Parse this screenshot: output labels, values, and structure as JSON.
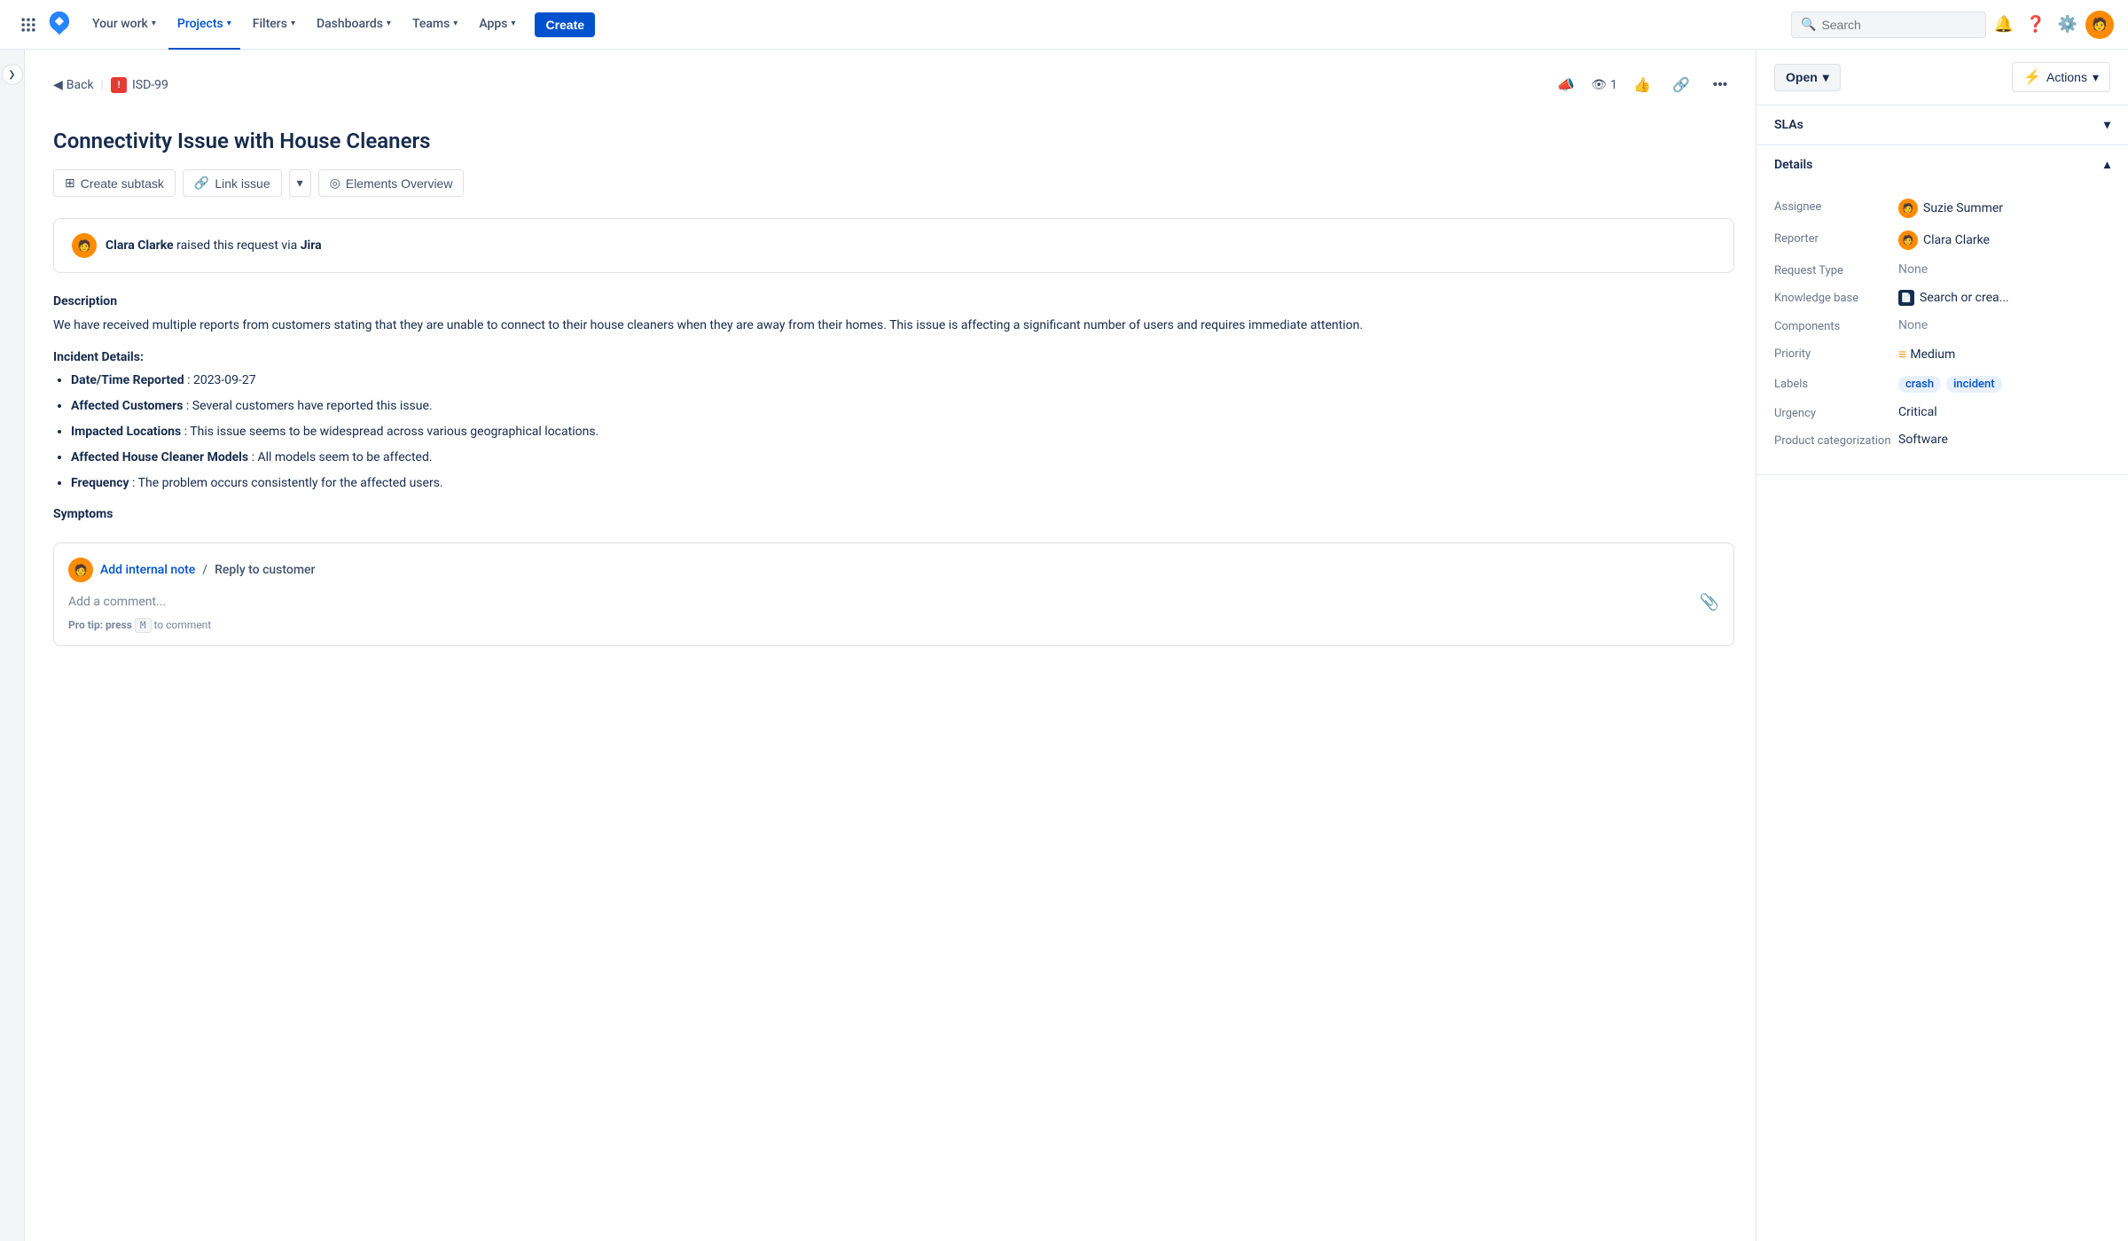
{
  "nav": {
    "your_work": "Your work",
    "projects": "Projects",
    "filters": "Filters",
    "dashboards": "Dashboards",
    "teams": "Teams",
    "apps": "Apps",
    "create": "Create",
    "search_placeholder": "Search"
  },
  "breadcrumb": {
    "back": "Back",
    "issue_id": "ISD-99"
  },
  "header_actions": {
    "watch_count": "1",
    "watch_label": "1"
  },
  "issue": {
    "title": "Connectivity Issue with House Cleaners",
    "toolbar": {
      "create_subtask": "Create subtask",
      "link_issue": "Link issue",
      "elements_overview": "Elements Overview"
    },
    "reporter_card": "raised this request via",
    "reporter_name": "Clara Clarke",
    "reporter_via": "Jira",
    "description_title": "Description",
    "description_text": "We have received multiple reports from customers stating that they are unable to connect to their house cleaners when they are away from their homes. This issue is affecting a significant number of users and requires immediate attention.",
    "incident_title": "Incident Details",
    "incident_items": [
      {
        "label": "Date/Time Reported",
        "value": "2023-09-27"
      },
      {
        "label": "Affected Customers",
        "value": "Several customers have reported this issue."
      },
      {
        "label": "Impacted Locations",
        "value": "This issue seems to be widespread across various geographical locations."
      },
      {
        "label": "Affected House Cleaner Models",
        "value": "All models seem to be affected."
      },
      {
        "label": "Frequency",
        "value": "The problem occurs consistently for the affected users."
      }
    ],
    "symptoms_title": "Symptoms",
    "comment": {
      "add_internal_note": "Add internal note",
      "reply_to_customer": "Reply to customer",
      "pro_tip": "Pro tip: press",
      "shortcut_key": "M",
      "pro_tip_suffix": "to comment"
    }
  },
  "right_panel": {
    "status": "Open",
    "actions": "Actions",
    "sla_label": "SLAs",
    "details_label": "Details",
    "assignee_label": "Assignee",
    "assignee_name": "Suzie Summer",
    "reporter_label": "Reporter",
    "reporter_name": "Clara Clarke",
    "request_type_label": "Request Type",
    "request_type_value": "None",
    "knowledge_base_label": "Knowledge base",
    "knowledge_base_value": "Search or crea...",
    "components_label": "Components",
    "components_value": "None",
    "priority_label": "Priority",
    "priority_value": "Medium",
    "labels_label": "Labels",
    "labels": [
      "crash",
      "incident"
    ],
    "urgency_label": "Urgency",
    "urgency_value": "Critical",
    "product_cat_label": "Product categorization",
    "product_cat_value": "Software"
  }
}
